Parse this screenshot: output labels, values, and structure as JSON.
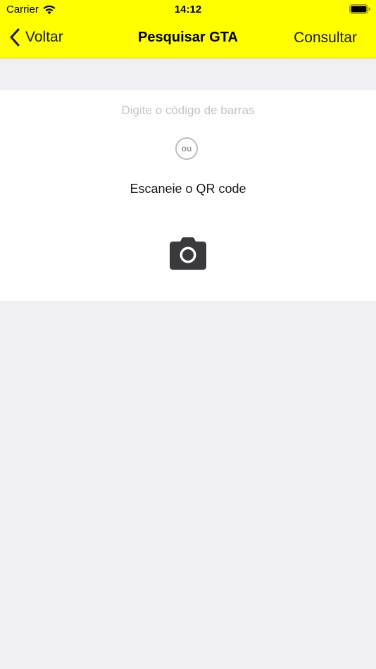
{
  "status_bar": {
    "carrier": "Carrier",
    "time": "14:12"
  },
  "nav": {
    "back_label": "Voltar",
    "title": "Pesquisar GTA",
    "action_label": "Consultar"
  },
  "search": {
    "barcode_placeholder": "Digite o código de barras",
    "or_label": "ou",
    "qr_label": "Escaneie o QR code"
  },
  "colors": {
    "header_bg": "#FFFF00",
    "page_bg": "#EFEFF4",
    "card_bg": "#FFFFFF",
    "icon_dark": "#3A3A3C"
  },
  "icons": {
    "wifi": "wifi-icon",
    "battery": "battery-icon",
    "back": "chevron-left-icon",
    "camera": "camera-icon"
  }
}
